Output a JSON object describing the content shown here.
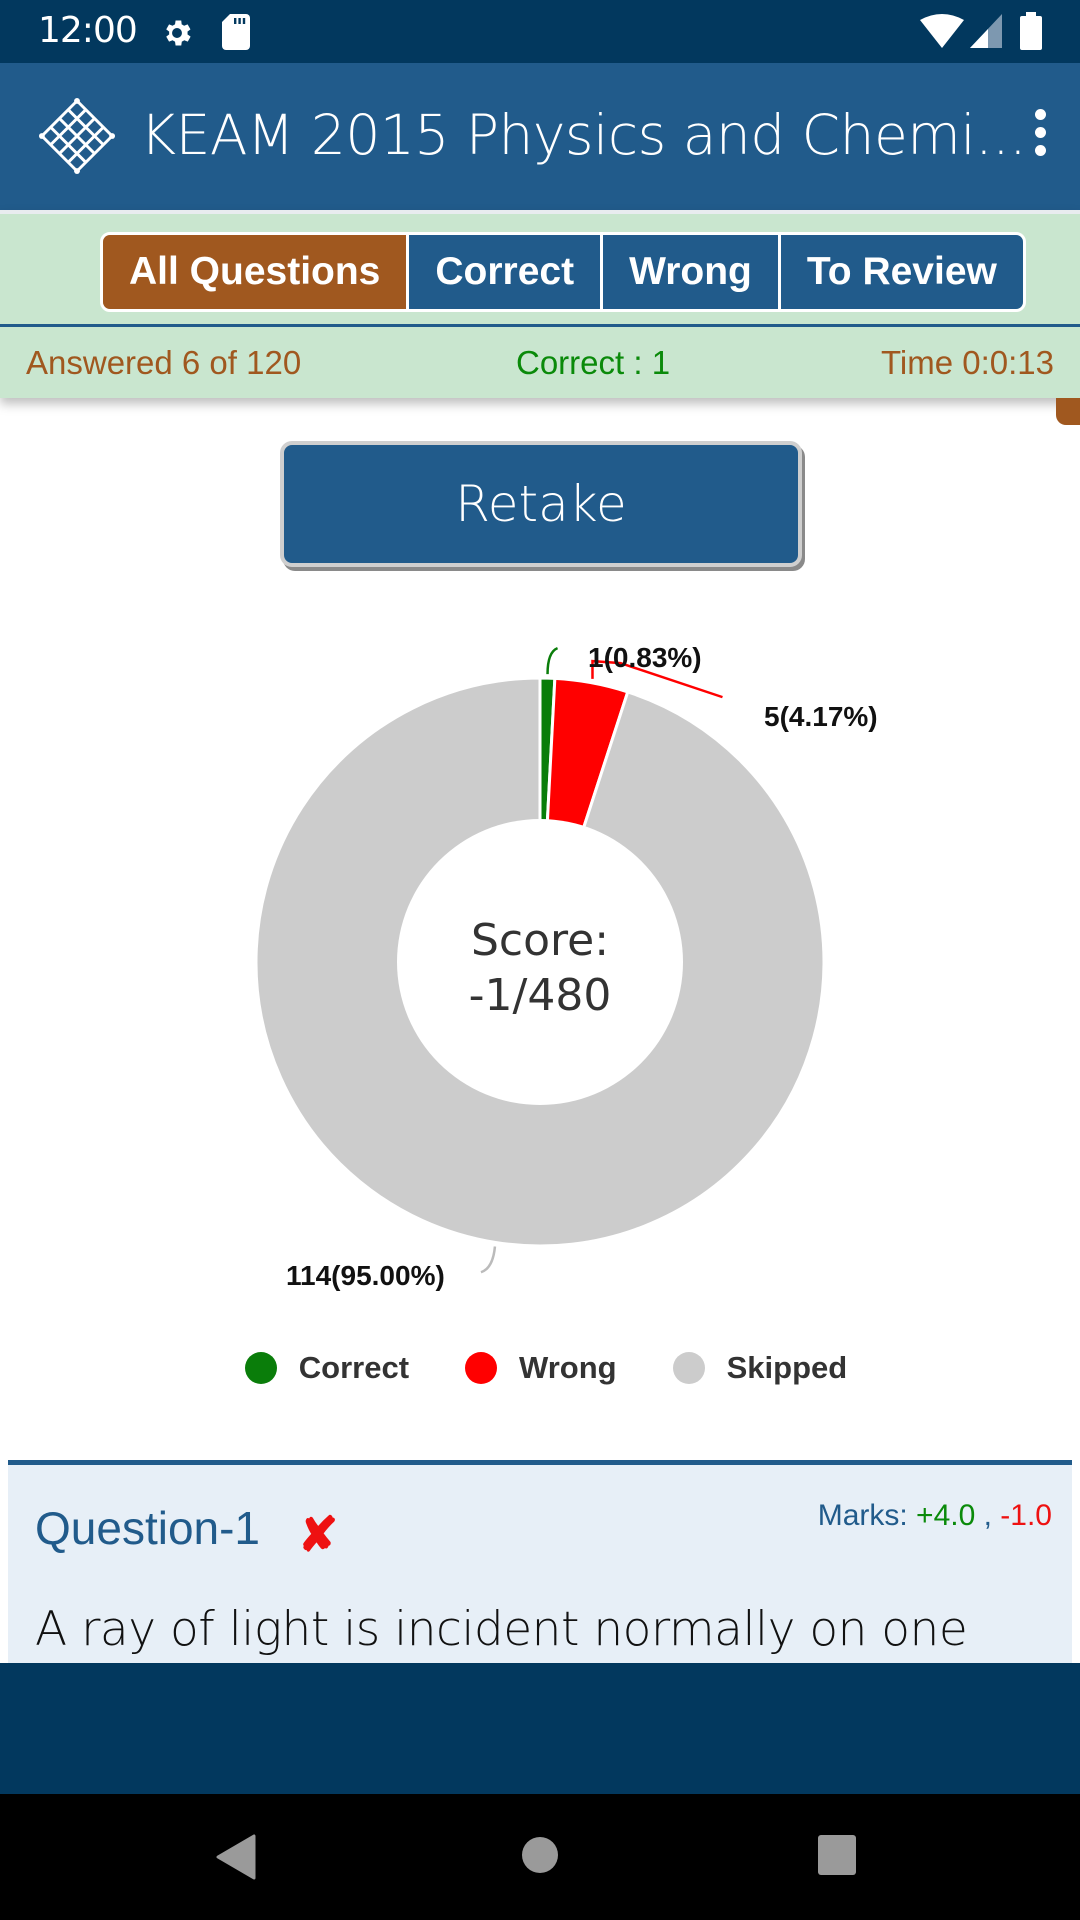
{
  "status_bar": {
    "time": "12:00",
    "icons": [
      "settings-icon",
      "sd-card-icon",
      "wifi-icon",
      "cell-signal-icon",
      "battery-icon"
    ]
  },
  "app_bar": {
    "title": "KEAM 2015 Physics and Chemi...",
    "logo": "mesh-diamond-logo",
    "menu_icon": "more-vert-icon"
  },
  "filter_tabs": [
    {
      "label": "All Questions",
      "active": true
    },
    {
      "label": "Correct",
      "active": false
    },
    {
      "label": "Wrong",
      "active": false
    },
    {
      "label": "To Review",
      "active": false
    }
  ],
  "stats": {
    "answered": "Answered 6 of 120",
    "correct": "Correct : 1",
    "time": "Time 0:0:13"
  },
  "retake_label": "Retake",
  "colors": {
    "primary": "#215b8b",
    "accent": "#a0581f",
    "status_bar": "#02385e",
    "correct": "#0a7d0a",
    "wrong": "#ff0000",
    "skipped": "#cccccc"
  },
  "chart_data": {
    "type": "pie",
    "variant": "donut",
    "center_text": [
      "Score:",
      "-1/480"
    ],
    "categories": [
      "Correct",
      "Wrong",
      "Skipped"
    ],
    "values": [
      1,
      5,
      114
    ],
    "percentages": [
      0.83,
      4.17,
      95.0
    ],
    "labels": [
      "1(0.83%)",
      "5(4.17%)",
      "114(95.00%)"
    ],
    "colors": [
      "#0a7d0a",
      "#ff0000",
      "#cccccc"
    ],
    "legend_position": "bottom"
  },
  "question": {
    "title": "Question-1",
    "status_icon": "wrong-cross-icon",
    "status_glyph": "✘",
    "marks_label": "Marks:",
    "marks_positive": "+4.0",
    "marks_separator": " , ",
    "marks_negative": "-1.0",
    "text": "A ray of light is incident normally on one refracting surface of an equilateral prism. If"
  }
}
